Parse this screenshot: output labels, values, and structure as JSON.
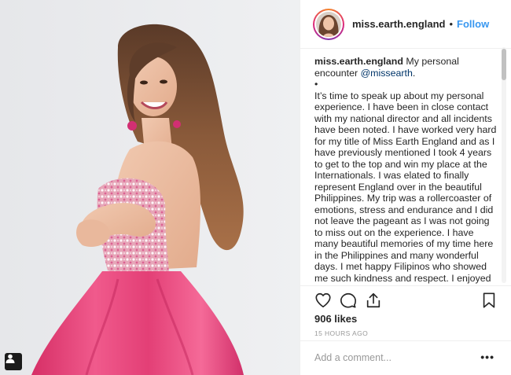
{
  "post": {
    "username": "miss.earth.england",
    "separator": "•",
    "follow_label": "Follow"
  },
  "caption": {
    "username": "miss.earth.england",
    "intro": " My personal encounter ",
    "mention": "@missearth",
    "intro_end": ".",
    "bullet": "•",
    "body": "It’s time to speak up about my personal experience. I have been in close contact with my national director and all incidents have been noted. I have worked very hard for my title of Miss Earth England and as I have previously mentioned I took 4 years to get to the top and win my place at the Internationals. I was elated to finally represent England over in the beautiful Philippines. My trip was a rollercoaster of emotions, stress and endurance and I did not leave the pageant as I was not going to miss out on the experience. I have many beautiful memories of my time here in the Philippines and many wonderful days. I met happy Filipinos who showed me such kindness and respect. I enjoyed"
  },
  "engagement": {
    "likes": "906 likes",
    "time_ago": "15 HOURS AGO"
  },
  "comment": {
    "placeholder": "Add a comment...",
    "more_label": "•••"
  },
  "icons": {
    "like": "heart-icon",
    "comment": "comment-bubble-icon",
    "share": "share-icon",
    "save": "bookmark-icon",
    "tag": "user-tag-icon"
  },
  "colors": {
    "link": "#3897f0",
    "dress": "#e8427a",
    "mention": "#003569"
  }
}
